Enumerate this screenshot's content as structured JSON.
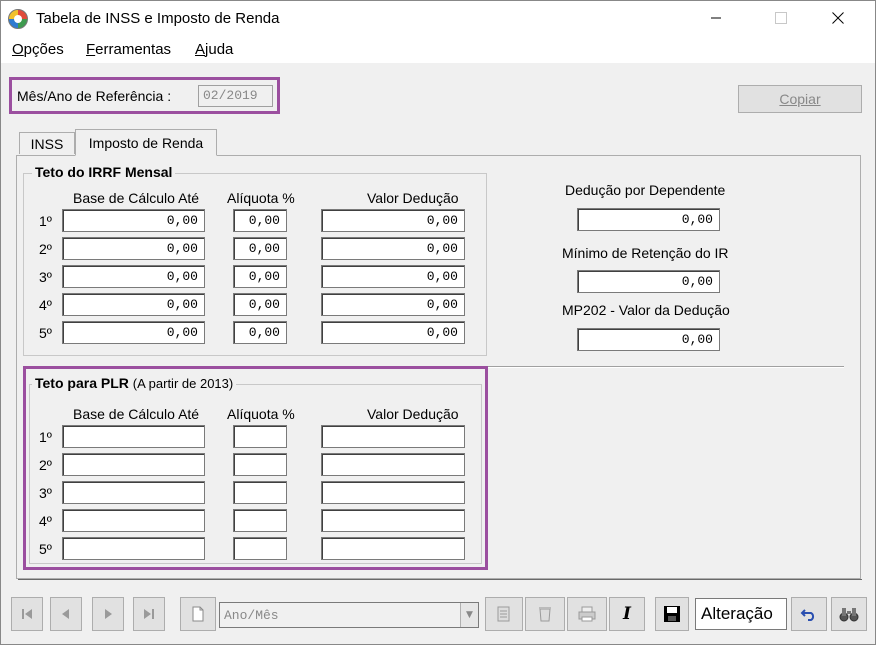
{
  "window": {
    "title": "Tabela de INSS e Imposto de Renda",
    "minimize_icon": "minimize-icon",
    "maximize_icon": "maximize-icon",
    "close_icon": "close-icon"
  },
  "menu": {
    "items": [
      {
        "underline": "O",
        "rest": "pções"
      },
      {
        "underline": "F",
        "rest": "erramentas"
      },
      {
        "underline": "A",
        "rest": "juda"
      }
    ]
  },
  "reference": {
    "label": "Mês/Ano de Referência :",
    "value": "02/2019"
  },
  "copy_button": "Copiar",
  "tabs": [
    {
      "label": "INSS",
      "active": false
    },
    {
      "label": "Imposto de Renda",
      "active": true
    }
  ],
  "irrf": {
    "title": "Teto do IRRF Mensal",
    "headers": {
      "base": "Base de Cálculo Até",
      "aliquota": "Alíquota %",
      "deducao": "Valor Dedução"
    },
    "rows": [
      {
        "label": "1º",
        "base": "0,00",
        "aliquota": "0,00",
        "deducao": "0,00"
      },
      {
        "label": "2º",
        "base": "0,00",
        "aliquota": "0,00",
        "deducao": "0,00"
      },
      {
        "label": "3º",
        "base": "0,00",
        "aliquota": "0,00",
        "deducao": "0,00"
      },
      {
        "label": "4º",
        "base": "0,00",
        "aliquota": "0,00",
        "deducao": "0,00"
      },
      {
        "label": "5º",
        "base": "0,00",
        "aliquota": "0,00",
        "deducao": "0,00"
      }
    ]
  },
  "side": {
    "dependente_label": "Dedução por Dependente",
    "dependente_value": "0,00",
    "minimo_label": "Mínimo de Retenção do IR",
    "minimo_value": "0,00",
    "mp202_label": "MP202 - Valor da Dedução",
    "mp202_value": "0,00"
  },
  "plr": {
    "title": "Teto para PLR",
    "subtitle": "(A partir de 2013)",
    "headers": {
      "base": "Base de Cálculo Até",
      "aliquota": "Alíquota %",
      "deducao": "Valor Dedução"
    },
    "rows": [
      {
        "label": "1º",
        "base": "",
        "aliquota": "",
        "deducao": ""
      },
      {
        "label": "2º",
        "base": "",
        "aliquota": "",
        "deducao": ""
      },
      {
        "label": "3º",
        "base": "",
        "aliquota": "",
        "deducao": ""
      },
      {
        "label": "4º",
        "base": "",
        "aliquota": "",
        "deducao": ""
      },
      {
        "label": "5º",
        "base": "",
        "aliquota": "",
        "deducao": ""
      }
    ]
  },
  "navigator": {
    "search_placeholder": "Ano/Mês",
    "status": "Alteração",
    "icons": [
      "first-icon",
      "prior-icon",
      "next-icon",
      "last-icon",
      "new-document-icon",
      "edit-icon",
      "delete-icon",
      "print-icon",
      "italic-icon",
      "save-icon",
      "undo-icon",
      "binoculars-icon"
    ]
  },
  "colors": {
    "highlight": "#9b4f9f"
  }
}
